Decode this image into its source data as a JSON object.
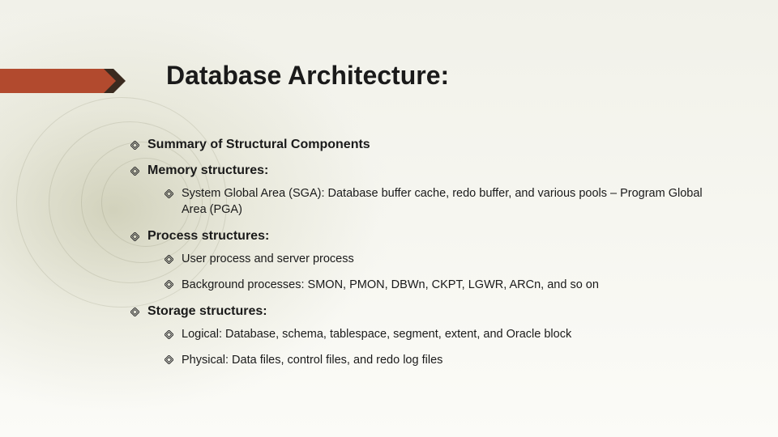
{
  "title": "Database Architecture:",
  "bullets": {
    "b0": "Summary of Structural Components",
    "b1": "Memory structures:",
    "b1_0": "System Global Area (SGA): Database buffer cache, redo buffer, and various pools – Program Global Area (PGA)",
    "b2": "Process structures:",
    "b2_0": "User process and server process",
    "b2_1": "Background processes: SMON, PMON, DBWn, CKPT, LGWR, ARCn, and so on",
    "b3": "Storage structures:",
    "b3_0": "Logical: Database, schema, tablespace, segment, extent, and Oracle block",
    "b3_1": "Physical: Data files, control files, and redo log files"
  }
}
